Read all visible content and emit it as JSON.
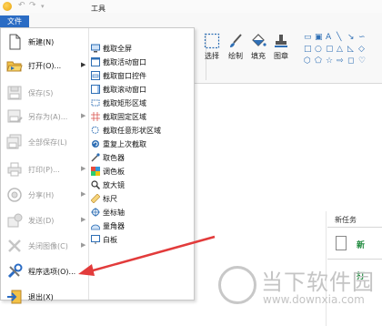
{
  "file_tab": {
    "label": "文件"
  },
  "ribbon": {
    "buttons": [
      {
        "label": "选择",
        "icon": "select-icon"
      },
      {
        "label": "绘制",
        "icon": "brush-icon"
      },
      {
        "label": "填充",
        "icon": "fill-bucket-icon"
      },
      {
        "label": "图章",
        "icon": "stamp-icon"
      }
    ],
    "group_label": "工具"
  },
  "file_menu": {
    "left_items": [
      {
        "label": "新建(N)",
        "enabled": true,
        "submenu": false,
        "icon": "new-document-icon"
      },
      {
        "label": "打开(O)...",
        "enabled": true,
        "submenu": true,
        "icon": "open-folder-icon"
      },
      {
        "label": "保存(S)",
        "enabled": false,
        "submenu": false,
        "icon": "save-icon"
      },
      {
        "label": "另存为(A)...",
        "enabled": false,
        "submenu": true,
        "icon": "save-as-icon"
      },
      {
        "label": "全部保存(L)",
        "enabled": false,
        "submenu": false,
        "icon": "save-all-icon"
      },
      {
        "label": "打印(P)...",
        "enabled": false,
        "submenu": true,
        "icon": "print-icon"
      },
      {
        "label": "分享(H)",
        "enabled": false,
        "submenu": true,
        "icon": "share-icon"
      },
      {
        "label": "发送(D)",
        "enabled": false,
        "submenu": true,
        "icon": "send-icon"
      },
      {
        "label": "关闭图像(C)",
        "enabled": false,
        "submenu": true,
        "icon": "close-image-icon"
      },
      {
        "label": "程序选项(O)...",
        "enabled": true,
        "submenu": false,
        "icon": "tools-icon"
      },
      {
        "label": "退出(X)",
        "enabled": true,
        "submenu": false,
        "icon": "exit-icon"
      }
    ],
    "tools_heading": "工具",
    "tools": [
      {
        "label": "截取全屏",
        "icon": "fullscreen-capture-icon"
      },
      {
        "label": "截取活动窗口",
        "icon": "active-window-capture-icon"
      },
      {
        "label": "截取窗口控件",
        "icon": "window-control-capture-icon"
      },
      {
        "label": "截取滚动窗口",
        "icon": "scrolling-window-capture-icon"
      },
      {
        "label": "截取矩形区域",
        "icon": "rectangle-capture-icon"
      },
      {
        "label": "截取固定区域",
        "icon": "fixed-region-capture-icon"
      },
      {
        "label": "截取任意形状区域",
        "icon": "freehand-capture-icon"
      },
      {
        "label": "重复上次截取",
        "icon": "repeat-capture-icon"
      },
      {
        "label": "取色器",
        "icon": "color-picker-icon"
      },
      {
        "label": "调色板",
        "icon": "palette-icon"
      },
      {
        "label": "放大镜",
        "icon": "magnifier-icon"
      },
      {
        "label": "标尺",
        "icon": "ruler-icon"
      },
      {
        "label": "坐标轴",
        "icon": "crosshair-icon"
      },
      {
        "label": "量角器",
        "icon": "protractor-icon"
      },
      {
        "label": "白板",
        "icon": "whiteboard-icon"
      }
    ]
  },
  "task_pane": {
    "title": "新任务",
    "item_label": "新",
    "item_label_2": "打"
  },
  "watermark": {
    "text": "当下软件园",
    "url": "www.downxia.com"
  },
  "colors": {
    "accent": "#2b6cc4",
    "arrow": "#e23b3b",
    "watermark": "#c4c4c4"
  }
}
